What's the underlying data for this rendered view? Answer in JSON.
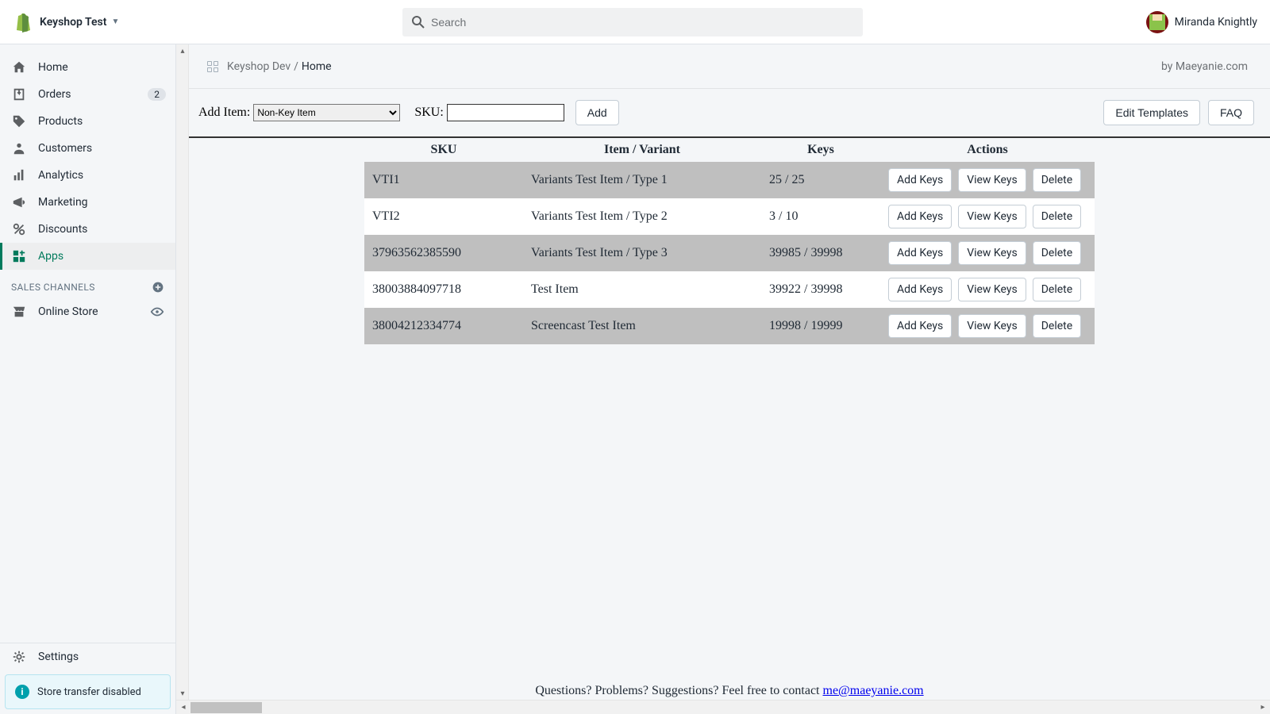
{
  "header": {
    "store_name": "Keyshop Test",
    "search_placeholder": "Search",
    "user_name": "Miranda Knightly"
  },
  "sidebar": {
    "items": [
      {
        "label": "Home"
      },
      {
        "label": "Orders",
        "badge": "2"
      },
      {
        "label": "Products"
      },
      {
        "label": "Customers"
      },
      {
        "label": "Analytics"
      },
      {
        "label": "Marketing"
      },
      {
        "label": "Discounts"
      },
      {
        "label": "Apps"
      }
    ],
    "section_label": "SALES CHANNELS",
    "channel_label": "Online Store",
    "settings_label": "Settings",
    "notice": "Store transfer disabled"
  },
  "breadcrumb": {
    "app": "Keyshop Dev",
    "page": "Home",
    "byline": "by Maeyanie.com"
  },
  "toolbar": {
    "add_item_label": "Add Item:",
    "select_value": "Non-Key Item",
    "sku_label": "SKU:",
    "add_btn": "Add",
    "edit_templates_btn": "Edit Templates",
    "faq_btn": "FAQ"
  },
  "table": {
    "headers": {
      "sku": "SKU",
      "item": "Item / Variant",
      "keys": "Keys",
      "actions": "Actions"
    },
    "action_labels": {
      "add": "Add Keys",
      "view": "View Keys",
      "delete": "Delete"
    },
    "rows": [
      {
        "sku": "VTI1",
        "item": "Variants Test Item / Type 1",
        "keys": "25 / 25"
      },
      {
        "sku": "VTI2",
        "item": "Variants Test Item / Type 2",
        "keys": "3 / 10"
      },
      {
        "sku": "37963562385590",
        "item": "Variants Test Item / Type 3",
        "keys": "39985 / 39998"
      },
      {
        "sku": "38003884097718",
        "item": "Test Item",
        "keys": "39922 / 39998"
      },
      {
        "sku": "38004212334774",
        "item": "Screencast Test Item",
        "keys": "19998 / 19999"
      }
    ]
  },
  "footer": {
    "text": "Questions? Problems? Suggestions? Feel free to contact ",
    "email": "me@maeyanie.com"
  }
}
